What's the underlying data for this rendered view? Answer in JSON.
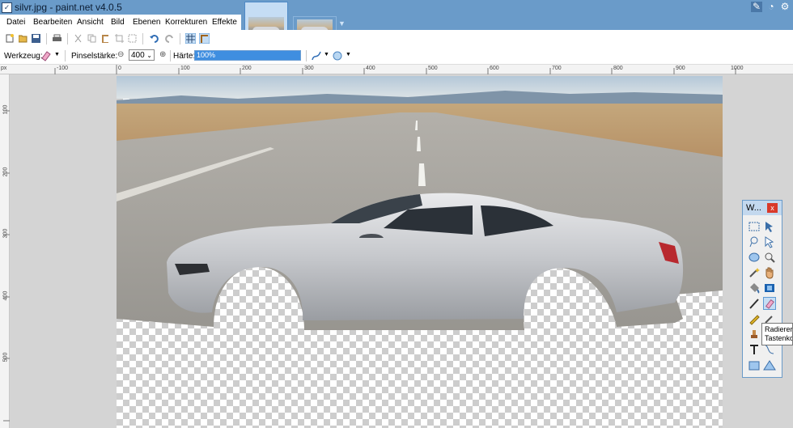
{
  "window": {
    "title": "silvr.jpg - paint.net v4.0.5"
  },
  "menu": [
    "Datei",
    "Bearbeiten",
    "Ansicht",
    "Bild",
    "Ebenen",
    "Korrekturen",
    "Effekte"
  ],
  "toolbar_options": {
    "tool_label": "Werkzeug:",
    "brush_width_label": "Pinselstärke:",
    "brush_width_value": "400",
    "hardness_label": "Härte:",
    "hardness_value": "100%"
  },
  "rulers": {
    "unit": "px",
    "top_labels": [
      "-100",
      "0",
      "100",
      "200",
      "300",
      "400",
      "500",
      "600",
      "700",
      "800",
      "900",
      "1000"
    ],
    "left_labels": [
      "100",
      "200",
      "300",
      "400",
      "500"
    ]
  },
  "tools_window": {
    "title": "W...",
    "close_label": "x"
  },
  "tooltip": {
    "line1": "Radierer",
    "line2": "Tastenko"
  },
  "colors": {
    "titlebar": "#6a9bc9",
    "accent": "#3f8ee0",
    "tool_selected": "#c5ddf4"
  }
}
